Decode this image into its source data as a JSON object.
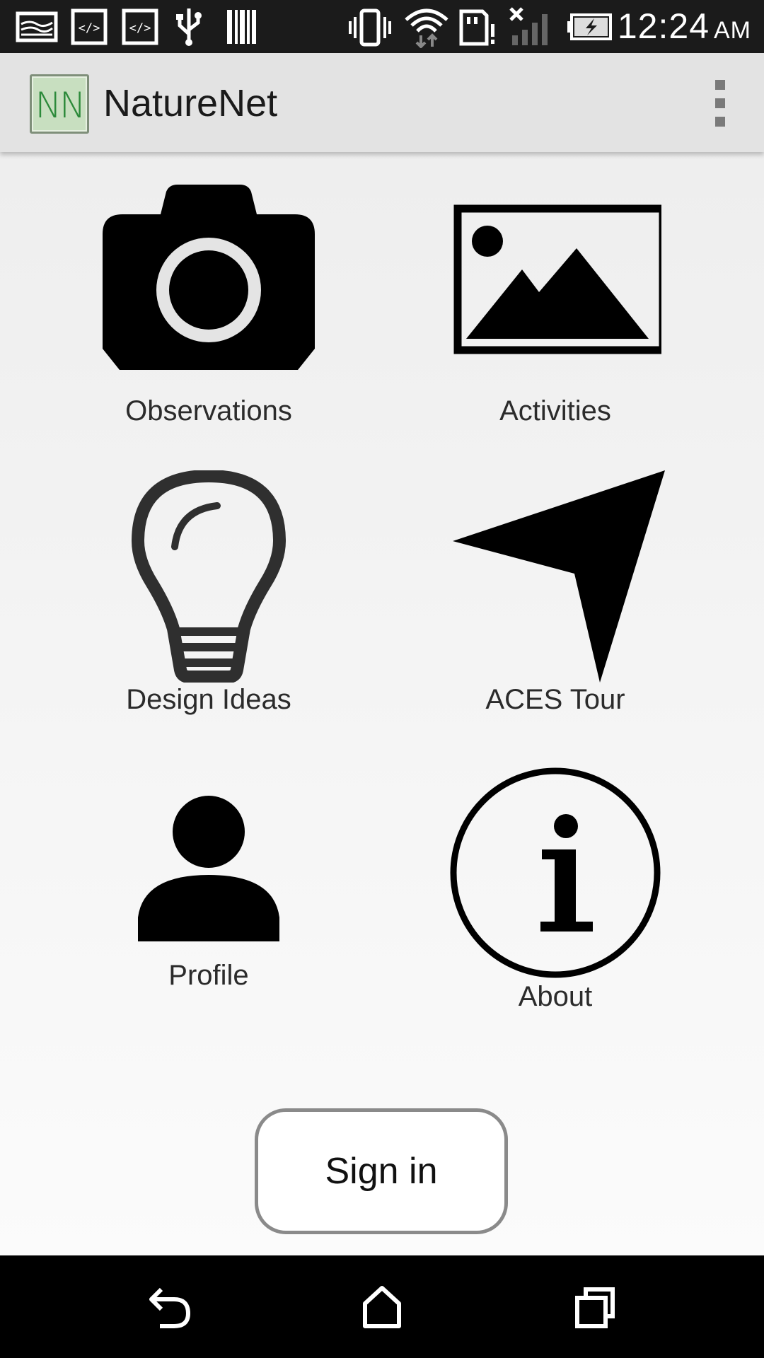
{
  "status_bar": {
    "time": "12:24",
    "ampm": "AM",
    "icons": [
      "image-notification-icon",
      "code-icon",
      "code-icon",
      "usb-icon",
      "barcode-icon",
      "vibrate-icon",
      "wifi-icon",
      "sd-card-alert-icon",
      "no-signal-icon",
      "battery-charging-icon"
    ]
  },
  "action_bar": {
    "logo_text": "NN",
    "title": "NatureNet"
  },
  "menu": {
    "items": [
      {
        "label": "Observations",
        "icon": "camera-icon"
      },
      {
        "label": "Activities",
        "icon": "picture-icon"
      },
      {
        "label": "Design Ideas",
        "icon": "lightbulb-icon"
      },
      {
        "label": "ACES Tour",
        "icon": "navigation-arrow-icon"
      },
      {
        "label": "Profile",
        "icon": "person-icon"
      },
      {
        "label": "About",
        "icon": "info-icon"
      }
    ]
  },
  "sign_in": {
    "label": "Sign in"
  },
  "nav_bar": {
    "icons": [
      "back-icon",
      "home-icon",
      "recents-icon"
    ]
  },
  "colors": {
    "action_bar": "#e3e3e3",
    "status_bar": "#1b1b1b",
    "logo_bg": "#c8dfc0",
    "logo_text": "#2c8a3a"
  }
}
